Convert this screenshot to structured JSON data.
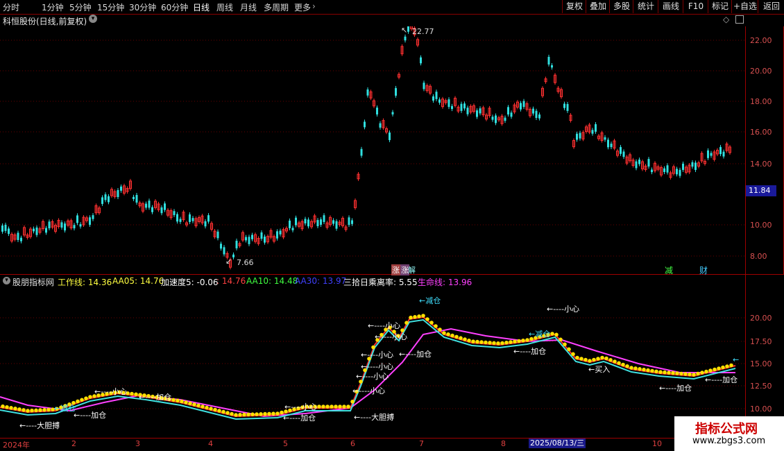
{
  "toolbar": {
    "timeframes": [
      "分时",
      "1分钟",
      "5分钟",
      "15分钟",
      "30分钟",
      "60分钟",
      "日线",
      "周线",
      "月线",
      "多周期",
      "更多"
    ],
    "active_timeframe": "日线",
    "buttons": [
      "复权",
      "叠加",
      "多股",
      "统计",
      "画线",
      "F10",
      "标记",
      "+自选",
      "返回"
    ]
  },
  "stock": {
    "title": "科恒股份(日线,前复权)",
    "price_high_label": "22.77",
    "price_low_label": "7.66",
    "current_price": "11.84",
    "price_ticks": [
      "22.00",
      "20.00",
      "18.00",
      "16.00",
      "14.00",
      "10.00",
      "8.00"
    ],
    "markers": {
      "jie": "解",
      "zhang": "涨",
      "jian": "减",
      "cai": "财"
    }
  },
  "indicator": {
    "name": "股朋指标网",
    "values": [
      {
        "label": "工作线: 14.36",
        "color": "#ffff40"
      },
      {
        "label": "AA05: 14.76",
        "color": "#ffff40"
      },
      {
        "label": "加速度5: -0.06",
        "color": "#ffffff"
      },
      {
        "label": ": 14.76",
        "color": "#ff4040"
      },
      {
        "label": "AA10: 14.48",
        "color": "#40ff40"
      },
      {
        "label": "AA30: 13.97",
        "color": "#4040ff"
      },
      {
        "label": "三拾日乘离率: 5.55",
        "color": "#ffffff"
      },
      {
        "label": "生命线: 13.96",
        "color": "#ff40ff"
      }
    ],
    "ticks": [
      "20.00",
      "17.50",
      "15.00",
      "12.50",
      "10.00"
    ],
    "annotations": {
      "jiancang": "←减仓",
      "xiaoxin": "←----小心",
      "jiacang": "←----加仓",
      "mairu": "←买入",
      "dadan": "←----大胆搏",
      "jiacang2": "加仓",
      "jiancang2": "减仓",
      "dadan2": "大胆搏"
    }
  },
  "xaxis": {
    "labels": [
      "2024年",
      "2",
      "3",
      "4",
      "5",
      "6",
      "7",
      "8",
      "10"
    ],
    "cursor_date": "2025/08/13/三"
  },
  "watermark": {
    "title": "指标公式网",
    "url": "www.zbgs3.com"
  }
}
